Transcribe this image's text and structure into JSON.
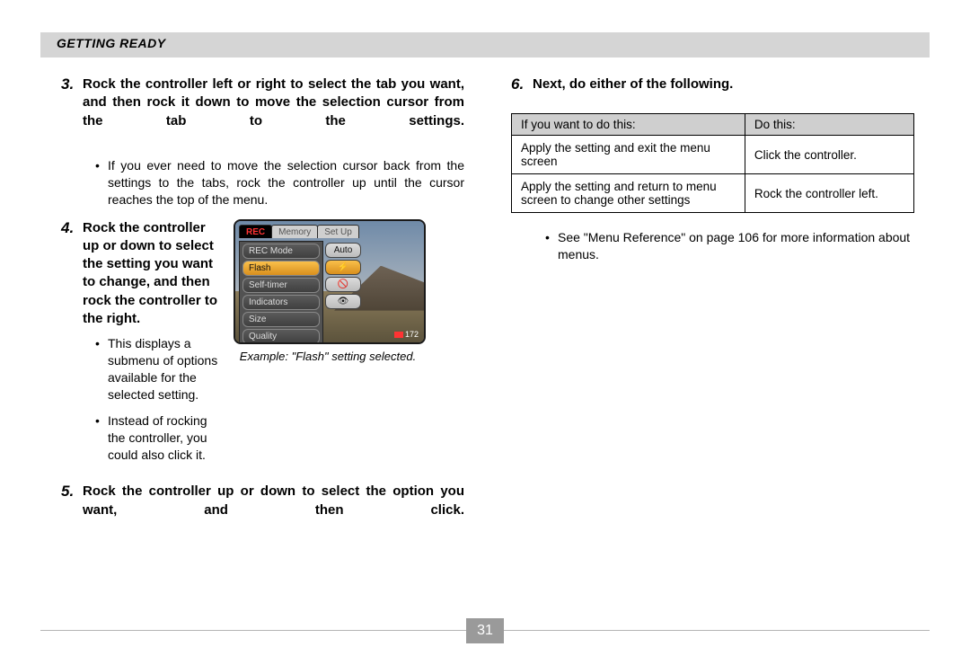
{
  "header": {
    "breadcrumb": "GETTING READY"
  },
  "left": {
    "step3": {
      "num": "3.",
      "head": "Rock the controller left or right to select the tab you want, and then rock it down to move the selection cursor from the tab to the settings."
    },
    "step3_bullets": [
      "If you ever need to move the selection cursor back from the settings to the tabs, rock the controller up until the cursor reaches the top of the menu."
    ],
    "step4": {
      "num": "4.",
      "head": "Rock the controller up or down to select the setting you want to change, and then rock the controller to the right."
    },
    "step4_bullets": [
      "This displays a submenu of options available for the selected setting.",
      "Instead of rocking the controller, you could also click it."
    ],
    "figure_caption": "Example: \"Flash\" setting selected.",
    "step5": {
      "num": "5.",
      "head": "Rock the controller up or down to select the option you want, and then click."
    }
  },
  "lcd": {
    "tabs": [
      "REC",
      "Memory",
      "Set Up"
    ],
    "menu": [
      "REC Mode",
      "Flash",
      "Self-timer",
      "Indicators",
      "Size",
      "Quality"
    ],
    "menu_selected_index": 1,
    "submenu": [
      "Auto",
      "⚡",
      "🚫",
      "👁"
    ],
    "submenu_selected_index": 1,
    "footer_count": "172"
  },
  "right": {
    "step6": {
      "num": "6.",
      "head": "Next, do either of the following."
    },
    "table": {
      "headers": [
        "If you want to do this:",
        "Do this:"
      ],
      "rows": [
        [
          "Apply the setting and exit the menu screen",
          "Click the controller."
        ],
        [
          "Apply the setting and return to menu screen to change other settings",
          "Rock the controller left."
        ]
      ]
    },
    "note": "See \"Menu Reference\" on page 106 for more information about menus."
  },
  "footer": {
    "page_number": "31"
  }
}
